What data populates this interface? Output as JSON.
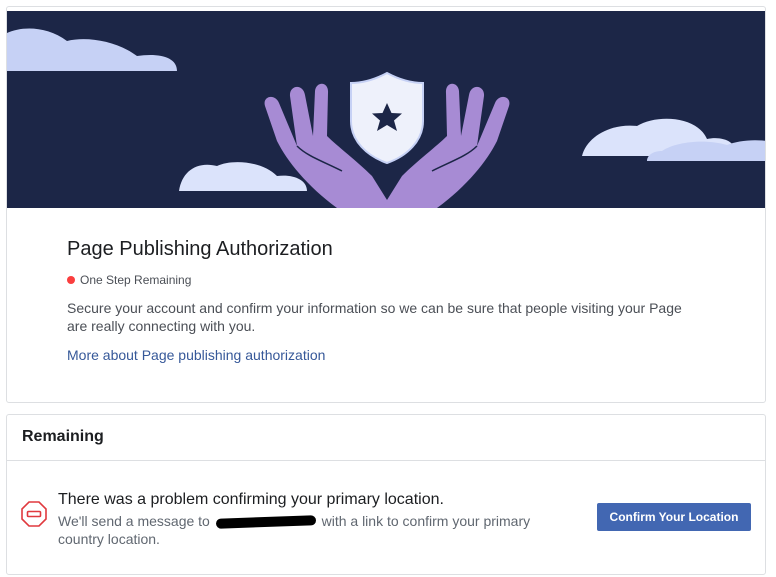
{
  "colors": {
    "banner_bg": "#1c2647",
    "accent_blue": "#4267b2",
    "link": "#365899",
    "status_red": "#fa3e3e",
    "hand_purple": "#a78bd4",
    "cloud": "#c6d1f5",
    "stop_red": "#e0393e"
  },
  "icons": {
    "banner": "hands-shield-star-illustration",
    "status": "red-dot",
    "problem": "stop-sign-icon"
  },
  "authorization": {
    "title": "Page Publishing Authorization",
    "status": "One Step Remaining",
    "description": "Secure your account and confirm your information so we can be sure that people visiting your Page are really connecting with you.",
    "more_link": "More about Page publishing authorization"
  },
  "remaining": {
    "header": "Remaining",
    "item": {
      "title": "There was a problem confirming your primary location.",
      "desc_before": "We'll send a message to",
      "desc_after": "with a link to confirm your primary country location.",
      "button": "Confirm Your Location"
    }
  }
}
